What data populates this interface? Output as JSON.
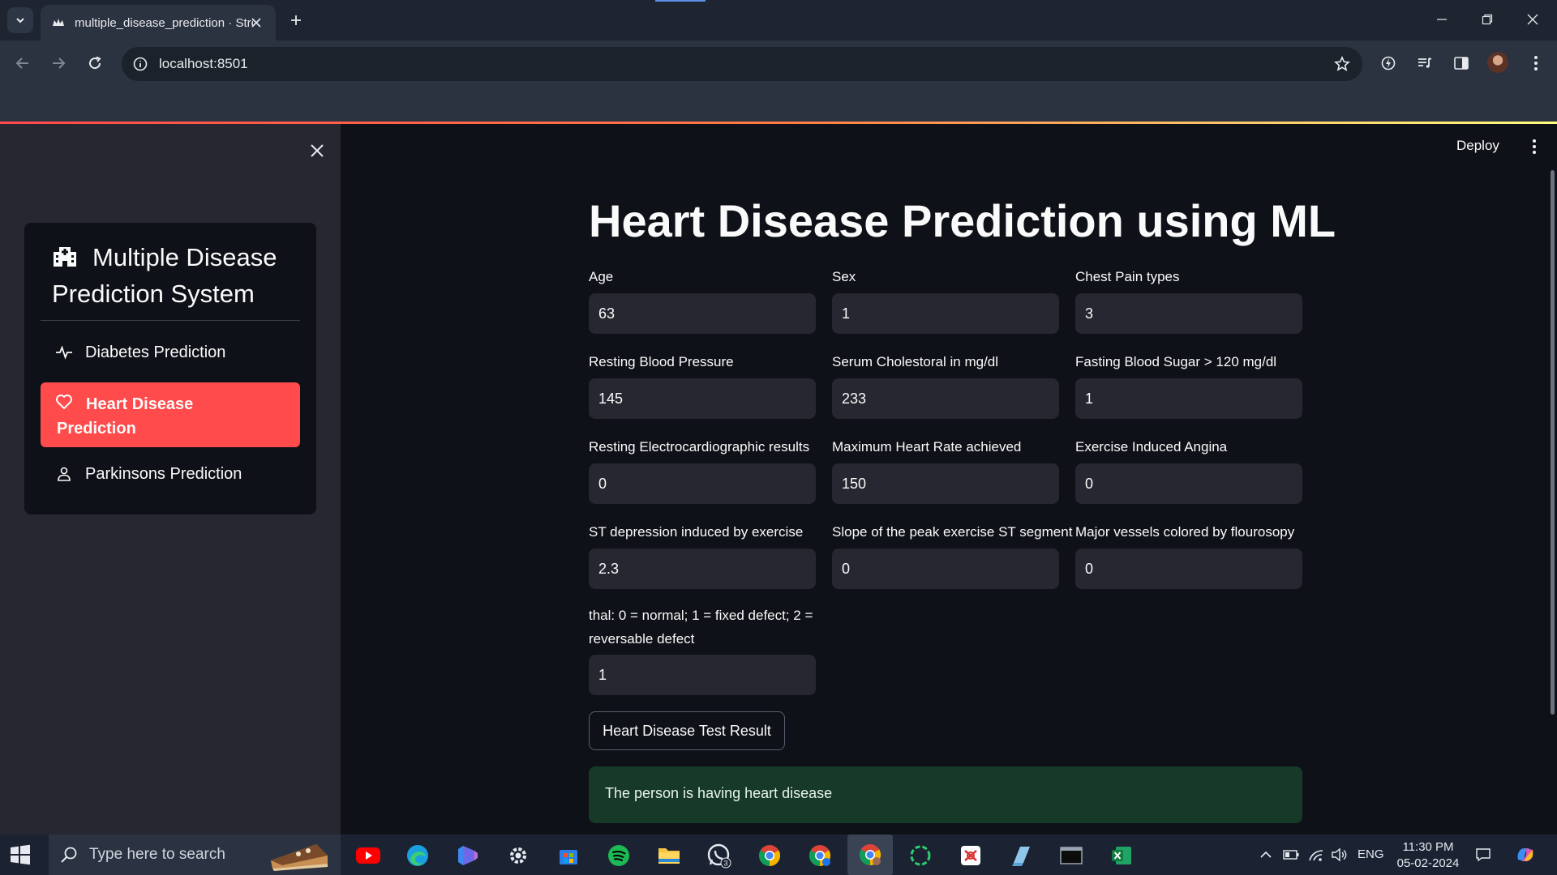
{
  "browser": {
    "tab_title": "multiple_disease_prediction · Streamlit",
    "url": "localhost:8501"
  },
  "app": {
    "deploy_label": "Deploy"
  },
  "sidebar": {
    "menu_title": "Multiple Disease Prediction System",
    "items": [
      {
        "label": "Diabetes Prediction",
        "icon": "activity-icon",
        "selected": false
      },
      {
        "label": "Heart Disease Prediction",
        "icon": "heart-icon",
        "selected": true
      },
      {
        "label": "Parkinsons Prediction",
        "icon": "person-icon",
        "selected": false
      }
    ]
  },
  "main": {
    "title": "Heart Disease Prediction using ML",
    "fields": {
      "age": {
        "label": "Age",
        "value": "63"
      },
      "sex": {
        "label": "Sex",
        "value": "1"
      },
      "cp": {
        "label": "Chest Pain types",
        "value": "3"
      },
      "trestbps": {
        "label": "Resting Blood Pressure",
        "value": "145"
      },
      "chol": {
        "label": "Serum Cholestoral in mg/dl",
        "value": "233"
      },
      "fbs": {
        "label": "Fasting Blood Sugar > 120 mg/dl",
        "value": "1"
      },
      "restecg": {
        "label": "Resting Electrocardiographic results",
        "value": "0"
      },
      "thalach": {
        "label": "Maximum Heart Rate achieved",
        "value": "150"
      },
      "exang": {
        "label": "Exercise Induced Angina",
        "value": "0"
      },
      "oldpeak": {
        "label": "ST depression induced by exercise",
        "value": "2.3"
      },
      "slope": {
        "label": "Slope of the peak exercise ST segment",
        "value": "0"
      },
      "ca": {
        "label": "Major vessels colored by flourosopy",
        "value": "0"
      },
      "thal": {
        "label_line1": "thal: 0 = normal; 1 = fixed defect; 2 =",
        "label_line2": "reversable defect",
        "value": "1"
      }
    },
    "button_label": "Heart Disease Test Result",
    "result_text": "The person is having heart disease"
  },
  "taskbar": {
    "search_placeholder": "Type here to search",
    "whatsapp_badge": "3",
    "language": "ENG",
    "time": "11:30 PM",
    "date": "05-02-2024"
  },
  "colors": {
    "accent": "#ff4b4b",
    "background": "#0e1117",
    "sidebar": "#262730",
    "success_bg": "#173928"
  }
}
